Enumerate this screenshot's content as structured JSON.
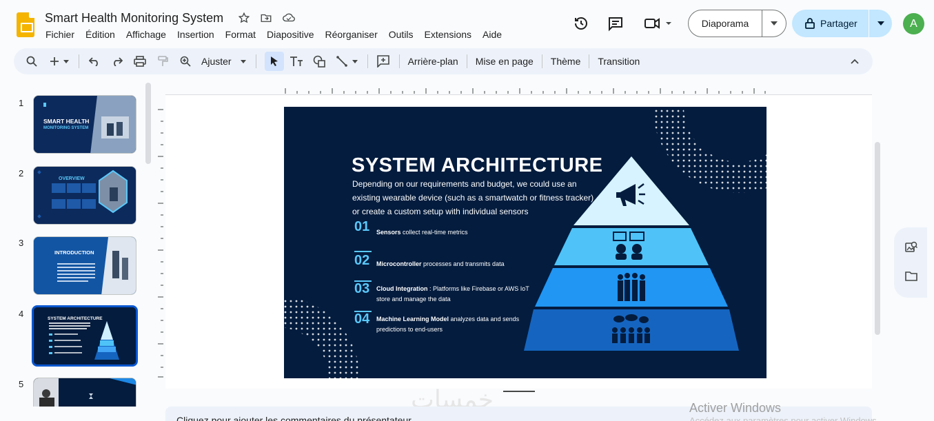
{
  "app": {
    "title": "Smart Health Monitoring System",
    "avatar_letter": "A"
  },
  "menu": [
    "Fichier",
    "Édition",
    "Affichage",
    "Insertion",
    "Format",
    "Diapositive",
    "Réorganiser",
    "Outils",
    "Extensions",
    "Aide"
  ],
  "header": {
    "slideshow_label": "Diaporama",
    "share_label": "Partager"
  },
  "toolbar": {
    "zoom_label": "Ajuster",
    "background_label": "Arrière-plan",
    "layout_label": "Mise en page",
    "theme_label": "Thème",
    "transition_label": "Transition"
  },
  "filmstrip": {
    "slides": [
      {
        "num": "1",
        "title": "SMART HEALTH",
        "subtitle": "MONITORING SYSTEM"
      },
      {
        "num": "2",
        "title": "OVERVIEW"
      },
      {
        "num": "3",
        "title": "INTRODUCTION"
      },
      {
        "num": "4",
        "title": "SYSTEM ARCHITECTURE"
      },
      {
        "num": "5",
        "title": ""
      }
    ],
    "active_index": 3
  },
  "slide": {
    "title": "SYSTEM ARCHITECTURE",
    "intro": "Depending on our requirements and budget, we could use an existing wearable device (such as a smartwatch or fitness tracker) or create a custom setup with individual sensors",
    "items": [
      {
        "num": "01",
        "bold": "Sensors",
        "text": " collect real-time metrics"
      },
      {
        "num": "02",
        "bold": "Microcontroller",
        "text": " processes and transmits data"
      },
      {
        "num": "03",
        "bold": "Cloud Integration",
        "text": " : Platforms like Firebase or AWS IoT store and manage the data"
      },
      {
        "num": "04",
        "bold": "Machine Learning Model",
        "text": " analyzes data and sends predictions to end-users"
      }
    ]
  },
  "notes_placeholder": "Cliquez pour ajouter les commentaires du présentateur",
  "watermark": "خمسات",
  "windows": {
    "activate_title": "Activer Windows",
    "activate_sub": "Accédez aux paramètres pour activer Windows."
  },
  "colors": {
    "slide_bg": "#041c3e",
    "accent": "#5ac8fa",
    "share_bg": "#c2e7ff",
    "active_border": "#0b57d0"
  }
}
